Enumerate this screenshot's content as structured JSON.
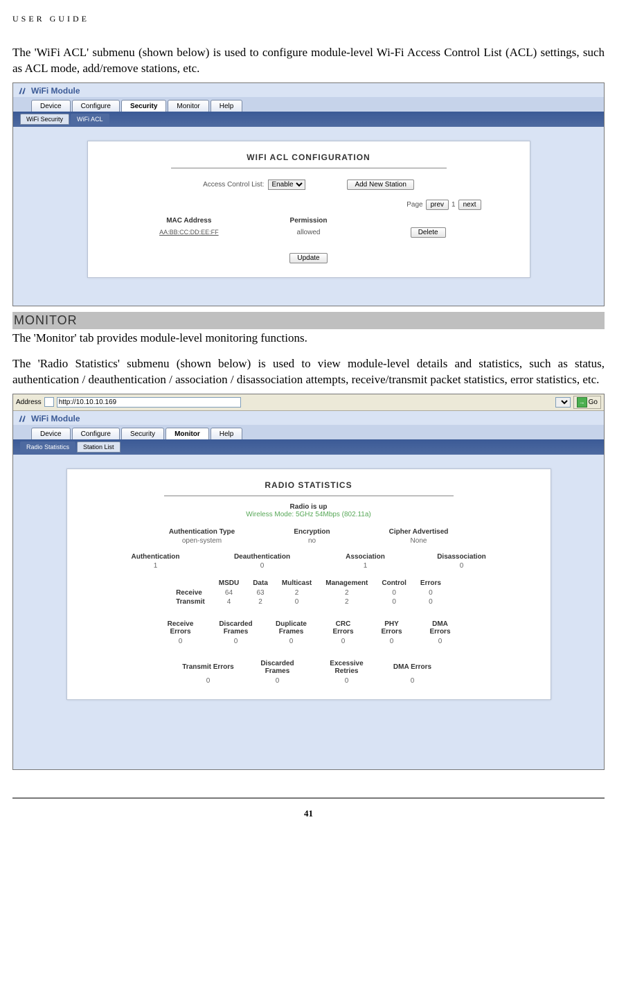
{
  "page_header": "USER GUIDE",
  "page_number": "41",
  "para1": "The 'WiFi ACL' submenu (shown below) is used to configure module-level Wi-Fi Access Control List (ACL) settings, such as ACL mode, add/remove stations, etc.",
  "section_monitor": "MONITOR",
  "para2": "The 'Monitor' tab provides module-level monitoring functions.",
  "para3": "The 'Radio Statistics' submenu (shown below) is used to view module-level details and statistics, such as status, authentication / deauthentication / association / disassociation attempts, receive/transmit packet statistics, error statistics, etc.",
  "shot1": {
    "app_title": "WiFi Module",
    "tabs": {
      "device": "Device",
      "configure": "Configure",
      "security": "Security",
      "monitor": "Monitor",
      "help": "Help"
    },
    "subtabs": {
      "wifi_security": "WiFi Security",
      "wifi_acl": "WiFi ACL"
    },
    "panel_title": "WIFI ACL CONFIGURATION",
    "acl_label": "Access Control List:",
    "acl_value": "Enable",
    "add_station": "Add New Station",
    "page_label": "Page",
    "prev": "prev",
    "page_no": "1",
    "next": "next",
    "mac_header": "MAC Address",
    "perm_header": "Permission",
    "mac": "AA:BB:CC:DD:EE:FF",
    "perm": "allowed",
    "delete": "Delete",
    "update": "Update"
  },
  "shot2": {
    "addr_label": "Address",
    "addr_value": "http://10.10.10.169",
    "go": "Go",
    "app_title": "WiFi Module",
    "tabs": {
      "device": "Device",
      "configure": "Configure",
      "security": "Security",
      "monitor": "Monitor",
      "help": "Help"
    },
    "subtabs": {
      "radio_stats": "Radio Statistics",
      "station_list": "Station List"
    },
    "panel_title": "RADIO STATISTICS",
    "radio_up": "Radio is  up",
    "wireless_mode": "Wireless Mode: 5GHz 54Mbps (802.11a)",
    "row1_h": {
      "auth_type": "Authentication Type",
      "encryption": "Encryption",
      "cipher": "Cipher Advertised"
    },
    "row1_v": {
      "auth_type": "open-system",
      "encryption": "no",
      "cipher": "None"
    },
    "row2_h": {
      "auth": "Authentication",
      "deauth": "Deauthentication",
      "assoc": "Association",
      "disassoc": "Disassociation"
    },
    "row2_v": {
      "auth": "1",
      "deauth": "0",
      "assoc": "1",
      "disassoc": "0"
    },
    "table1": {
      "cols": {
        "msdu": "MSDU",
        "data": "Data",
        "mcast": "Multicast",
        "mgmt": "Management",
        "ctrl": "Control",
        "err": "Errors"
      },
      "receive_label": "Receive",
      "transmit_label": "Transmit",
      "receive": {
        "msdu": "64",
        "data": "63",
        "mcast": "2",
        "mgmt": "2",
        "ctrl": "0",
        "err": "0"
      },
      "transmit": {
        "msdu": "4",
        "data": "2",
        "mcast": "0",
        "mgmt": "2",
        "ctrl": "0",
        "err": "0"
      }
    },
    "table2": {
      "cols": {
        "recv_err": "Receive Errors",
        "disc": "Discarded Frames",
        "dup": "Duplicate Frames",
        "crc": "CRC Errors",
        "phy": "PHY Errors",
        "dma": "DMA Errors"
      },
      "vals": {
        "recv_err": "0",
        "disc": "0",
        "dup": "0",
        "crc": "0",
        "phy": "0",
        "dma": "0"
      }
    },
    "table3": {
      "cols": {
        "tx_err": "Transmit Errors",
        "disc": "Discarded Frames",
        "retry": "Excessive Retries",
        "dma": "DMA Errors"
      },
      "vals": {
        "tx_err": "0",
        "disc": "0",
        "retry": "0",
        "dma": "0"
      }
    }
  }
}
